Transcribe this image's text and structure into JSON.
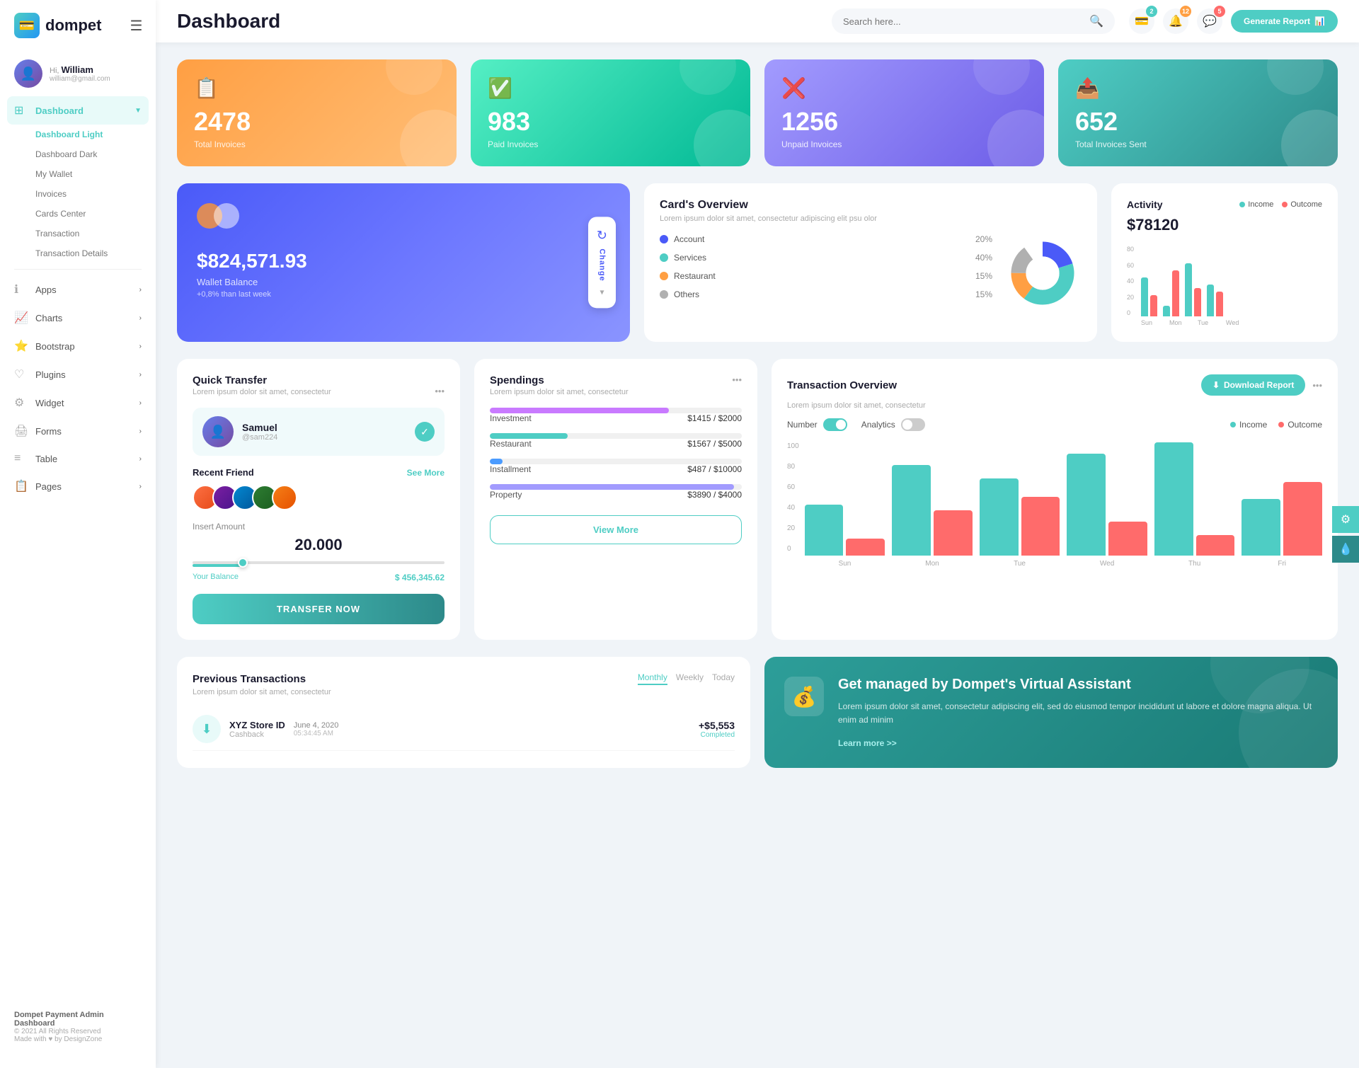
{
  "app": {
    "name": "dompet",
    "title": "Dashboard"
  },
  "header": {
    "title": "Dashboard",
    "search_placeholder": "Search here...",
    "generate_report_label": "Generate Report",
    "badges": {
      "wallet": "2",
      "bell": "12",
      "chat": "5"
    }
  },
  "sidebar": {
    "user": {
      "greeting": "Hi,",
      "name": "William",
      "email": "william@gmail.com"
    },
    "nav_items": [
      {
        "id": "dashboard",
        "label": "Dashboard",
        "icon": "⊞",
        "active": true,
        "has_arrow": true
      },
      {
        "id": "apps",
        "label": "Apps",
        "icon": "ℹ",
        "has_arrow": true
      },
      {
        "id": "charts",
        "label": "Charts",
        "icon": "📈",
        "has_arrow": true
      },
      {
        "id": "bootstrap",
        "label": "Bootstrap",
        "icon": "⭐",
        "has_arrow": true
      },
      {
        "id": "plugins",
        "label": "Plugins",
        "icon": "♡",
        "has_arrow": true
      },
      {
        "id": "widget",
        "label": "Widget",
        "icon": "⚙",
        "has_arrow": true
      },
      {
        "id": "forms",
        "label": "Forms",
        "icon": "🖨",
        "has_arrow": true
      },
      {
        "id": "table",
        "label": "Table",
        "icon": "≡",
        "has_arrow": true
      },
      {
        "id": "pages",
        "label": "Pages",
        "icon": "📋",
        "has_arrow": true
      }
    ],
    "sub_items": [
      {
        "label": "Dashboard Light",
        "active": true
      },
      {
        "label": "Dashboard Dark",
        "active": false
      },
      {
        "label": "My Wallet",
        "active": false
      },
      {
        "label": "Invoices",
        "active": false
      },
      {
        "label": "Cards Center",
        "active": false
      },
      {
        "label": "Transaction",
        "active": false
      },
      {
        "label": "Transaction Details",
        "active": false
      }
    ],
    "footer": {
      "title": "Dompet Payment Admin Dashboard",
      "copyright": "© 2021 All Rights Reserved",
      "made_with": "Made with ♥ by DesignZone"
    }
  },
  "stats": [
    {
      "id": "total_invoices",
      "number": "2478",
      "label": "Total Invoices",
      "color": "orange",
      "icon": "📋"
    },
    {
      "id": "paid_invoices",
      "number": "983",
      "label": "Paid Invoices",
      "color": "green",
      "icon": "✓"
    },
    {
      "id": "unpaid_invoices",
      "number": "1256",
      "label": "Unpaid Invoices",
      "color": "purple",
      "icon": "✗"
    },
    {
      "id": "total_sent",
      "number": "652",
      "label": "Total Invoices Sent",
      "color": "teal",
      "icon": "📋"
    }
  ],
  "wallet": {
    "amount": "$824,571.93",
    "label": "Wallet Balance",
    "change": "+0,8% than last week",
    "change_btn_label": "Change"
  },
  "cards_overview": {
    "title": "Card's Overview",
    "subtitle": "Lorem ipsum dolor sit amet, consectetur adipiscing elit psu olor",
    "legend": [
      {
        "label": "Account",
        "pct": "20%",
        "color": "#4a5af8"
      },
      {
        "label": "Services",
        "pct": "40%",
        "color": "#4ecdc4"
      },
      {
        "label": "Restaurant",
        "pct": "15%",
        "color": "#ff9f43"
      },
      {
        "label": "Others",
        "pct": "15%",
        "color": "#b0b0b0"
      }
    ]
  },
  "activity": {
    "title": "Activity",
    "amount": "$78120",
    "income_label": "Income",
    "outcome_label": "Outcome",
    "bars": [
      {
        "day": "Sun",
        "income": 55,
        "outcome": 30
      },
      {
        "day": "Mon",
        "income": 15,
        "outcome": 65
      },
      {
        "day": "Tue",
        "income": 75,
        "outcome": 40
      },
      {
        "day": "Wed",
        "income": 45,
        "outcome": 35
      }
    ]
  },
  "quick_transfer": {
    "title": "Quick Transfer",
    "subtitle": "Lorem ipsum dolor sit amet, consectetur",
    "user": {
      "name": "Samuel",
      "handle": "@sam224"
    },
    "recent_friend_label": "Recent Friend",
    "see_more_label": "See More",
    "amount_label": "Insert Amount",
    "amount_value": "20.000",
    "balance_label": "Your Balance",
    "balance_value": "$ 456,345.62",
    "transfer_btn_label": "TRANSFER NOW"
  },
  "spendings": {
    "title": "Spendings",
    "subtitle": "Lorem ipsum dolor sit amet, consectetur",
    "items": [
      {
        "name": "Investment",
        "amount": "$1415",
        "max": "$2000",
        "pct": 71,
        "color": "#c97aff"
      },
      {
        "name": "Restaurant",
        "amount": "$1567",
        "max": "$5000",
        "pct": 31,
        "color": "#4ecdc4"
      },
      {
        "name": "Installment",
        "amount": "$487",
        "max": "$10000",
        "pct": 5,
        "color": "#4a9bff"
      },
      {
        "name": "Property",
        "amount": "$3890",
        "max": "$4000",
        "pct": 97,
        "color": "#a29bfe"
      }
    ],
    "view_more_label": "View More"
  },
  "transaction_overview": {
    "title": "Transaction Overview",
    "subtitle": "Lorem ipsum dolor sit amet, consectetur",
    "download_btn_label": "Download Report",
    "toggle_number_label": "Number",
    "toggle_analytics_label": "Analytics",
    "income_label": "Income",
    "outcome_label": "Outcome",
    "bars": [
      {
        "day": "Sun",
        "income": 45,
        "outcome": 15
      },
      {
        "day": "Mon",
        "income": 80,
        "outcome": 40
      },
      {
        "day": "Tue",
        "income": 68,
        "outcome": 52
      },
      {
        "day": "Wed",
        "income": 90,
        "outcome": 30
      },
      {
        "day": "Thu",
        "income": 100,
        "outcome": 18
      },
      {
        "day": "Fri",
        "income": 50,
        "outcome": 65
      }
    ]
  },
  "previous_transactions": {
    "title": "Previous Transactions",
    "subtitle": "Lorem ipsum dolor sit amet, consectetur",
    "tabs": [
      "Monthly",
      "Weekly",
      "Today"
    ],
    "active_tab": "Monthly",
    "items": [
      {
        "name": "XYZ Store ID",
        "type": "Cashback",
        "date": "June 4, 2020",
        "time": "05:34:45 AM",
        "amount": "+$5,553",
        "status": "Completed"
      }
    ]
  },
  "virtual_assistant": {
    "title": "Get managed by Dompet's Virtual Assistant",
    "description": "Lorem ipsum dolor sit amet, consectetur adipiscing elit, sed do eiusmod tempor incididunt ut labore et dolore magna aliqua. Ut enim ad minim",
    "link_label": "Learn more >>"
  }
}
